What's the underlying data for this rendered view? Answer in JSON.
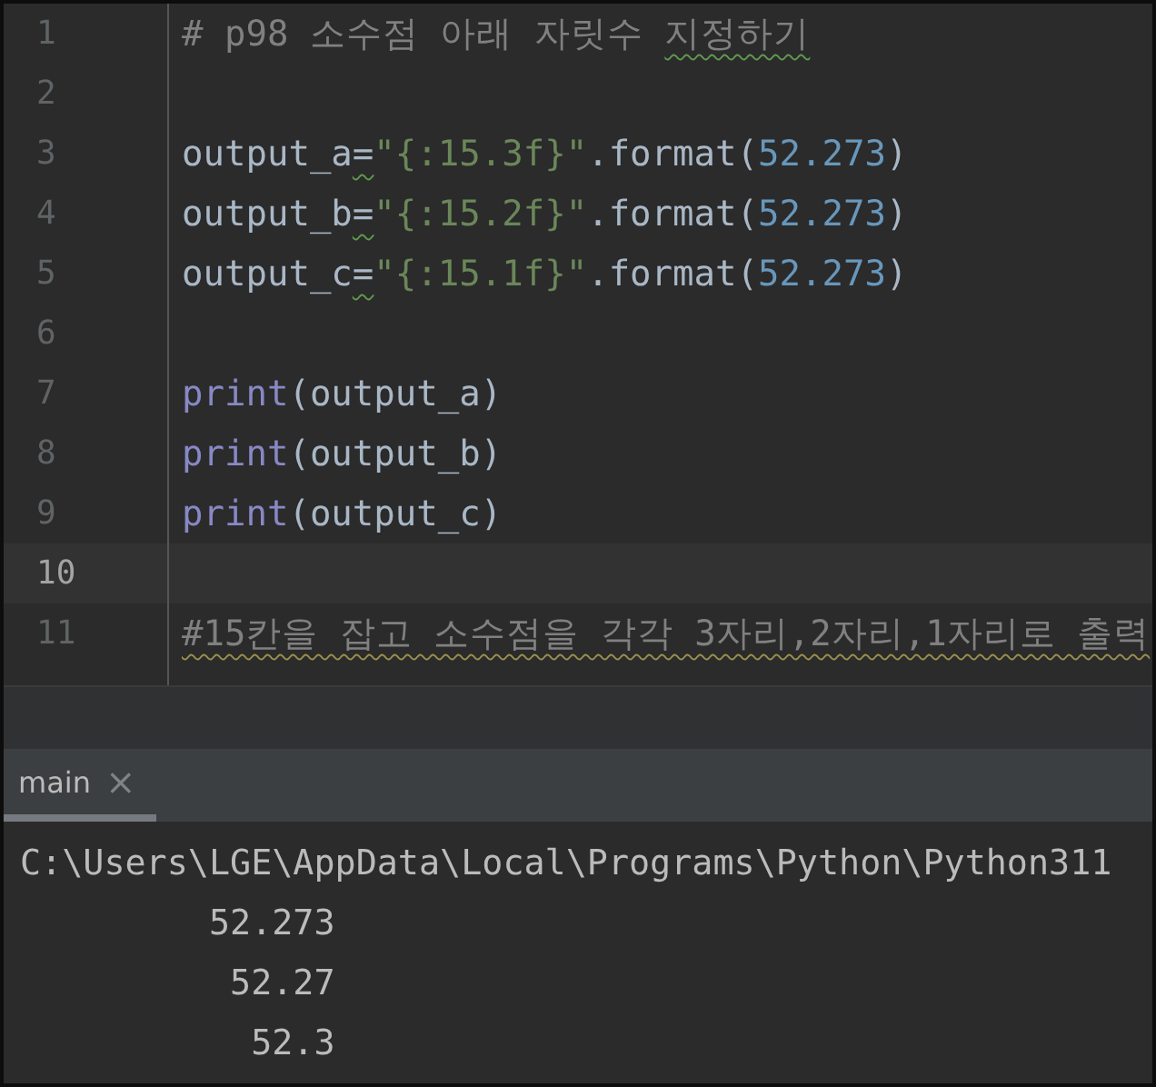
{
  "editor": {
    "lines": [
      {
        "number": "1",
        "current": false,
        "tokens": [
          {
            "text": "# p98 소수점 아래 자릿수 ",
            "kind": "comment",
            "typo": false,
            "weak_warning": false
          },
          {
            "text": "지정하기",
            "kind": "comment",
            "typo": true,
            "weak_warning": false
          }
        ]
      },
      {
        "number": "2",
        "current": false
      },
      {
        "number": "3",
        "current": false,
        "tokens": [
          {
            "text": "output_a",
            "kind": "plain",
            "typo": false,
            "weak_warning": false
          },
          {
            "text": "=",
            "kind": "plain",
            "typo": true,
            "weak_warning": false
          },
          {
            "text": "\"{:15.3f}\"",
            "kind": "string",
            "typo": false,
            "weak_warning": false
          },
          {
            "text": ".format(",
            "kind": "plain",
            "typo": false,
            "weak_warning": false
          },
          {
            "text": "52.273",
            "kind": "number",
            "typo": false,
            "weak_warning": false
          },
          {
            "text": ")",
            "kind": "plain",
            "typo": false,
            "weak_warning": false
          }
        ]
      },
      {
        "number": "4",
        "current": false,
        "tokens": [
          {
            "text": "output_b",
            "kind": "plain",
            "typo": false,
            "weak_warning": false
          },
          {
            "text": "=",
            "kind": "plain",
            "typo": true,
            "weak_warning": false
          },
          {
            "text": "\"{:15.2f}\"",
            "kind": "string",
            "typo": false,
            "weak_warning": false
          },
          {
            "text": ".format(",
            "kind": "plain",
            "typo": false,
            "weak_warning": false
          },
          {
            "text": "52.273",
            "kind": "number",
            "typo": false,
            "weak_warning": false
          },
          {
            "text": ")",
            "kind": "plain",
            "typo": false,
            "weak_warning": false
          }
        ]
      },
      {
        "number": "5",
        "current": false,
        "tokens": [
          {
            "text": "output_c",
            "kind": "plain",
            "typo": false,
            "weak_warning": false
          },
          {
            "text": "=",
            "kind": "plain",
            "typo": true,
            "weak_warning": false
          },
          {
            "text": "\"{:15.1f}\"",
            "kind": "string",
            "typo": false,
            "weak_warning": false
          },
          {
            "text": ".format(",
            "kind": "plain",
            "typo": false,
            "weak_warning": false
          },
          {
            "text": "52.273",
            "kind": "number",
            "typo": false,
            "weak_warning": false
          },
          {
            "text": ")",
            "kind": "plain",
            "typo": false,
            "weak_warning": false
          }
        ]
      },
      {
        "number": "6",
        "current": false
      },
      {
        "number": "7",
        "current": false,
        "tokens": [
          {
            "text": "print",
            "kind": "builtin",
            "typo": false,
            "weak_warning": false
          },
          {
            "text": "(output_a)",
            "kind": "plain",
            "typo": false,
            "weak_warning": false
          }
        ]
      },
      {
        "number": "8",
        "current": false,
        "tokens": [
          {
            "text": "print",
            "kind": "builtin",
            "typo": false,
            "weak_warning": false
          },
          {
            "text": "(output_b)",
            "kind": "plain",
            "typo": false,
            "weak_warning": false
          }
        ]
      },
      {
        "number": "9",
        "current": false,
        "tokens": [
          {
            "text": "print",
            "kind": "builtin",
            "typo": false,
            "weak_warning": false
          },
          {
            "text": "(output_c)",
            "kind": "plain",
            "typo": false,
            "weak_warning": false
          }
        ]
      },
      {
        "number": "10",
        "current": true
      },
      {
        "number": "11",
        "current": false,
        "tokens": [
          {
            "text": "#15칸을 잡고 소수점을 각각 3자리,2자리,1자리로 출력",
            "kind": "comment",
            "typo": false,
            "weak_warning": true
          }
        ]
      }
    ]
  },
  "run_panel": {
    "tabs": [
      {
        "label": "main",
        "close": "×",
        "selected": true
      }
    ],
    "console": [
      "C:\\Users\\LGE\\AppData\\Local\\Programs\\Python\\Python311",
      "         52.273",
      "          52.27",
      "           52.3"
    ]
  }
}
